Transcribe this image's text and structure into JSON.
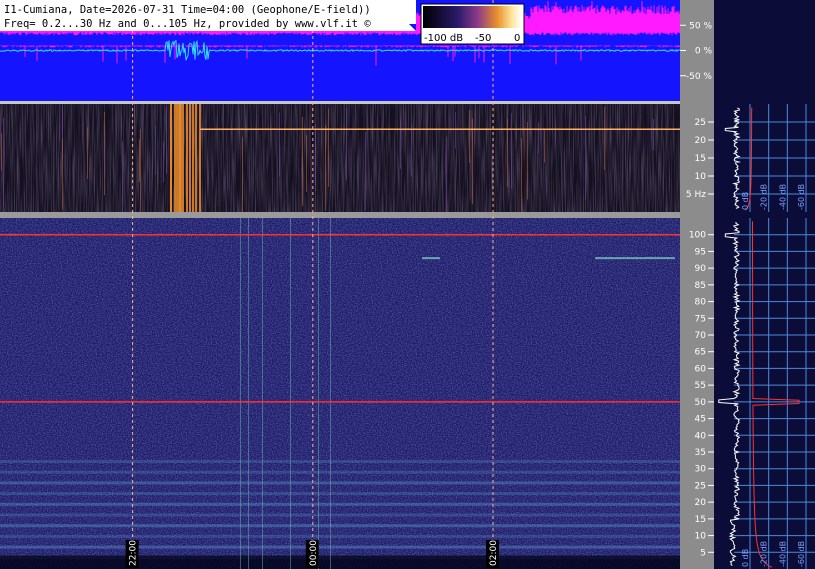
{
  "header": {
    "line1": "I1-Cumiana, Date=2026-07-31 Time=04:00 (Geophone/E-field))",
    "line2": "Freq= 0.2...30 Hz and 0...105 Hz, provided by www.vlf.it ©"
  },
  "colorbar": {
    "labels": [
      "-100 dB",
      "-50",
      "0"
    ]
  },
  "colors": {
    "top_background": "#1414ff",
    "amplitude_trace": "#ff1aff",
    "field_trace": "#30e0ff",
    "low_spec_bg": "#141020",
    "high_spec_bg": "#1c1c6a",
    "axis_panel": "#8c8c8c",
    "side_panel": "#0c0c38",
    "grid_line": "#4a8cd8",
    "marker_line": "#ff3030",
    "time_marker": "#ffb088"
  },
  "chart_data": [
    {
      "type": "line",
      "panel": "amplitude-percent",
      "ylim": [
        -100,
        100
      ],
      "yticks": [
        50,
        0,
        -50
      ],
      "ytick_labels": [
        "50 %",
        "0 %",
        "-50 %"
      ]
    },
    {
      "type": "heatmap",
      "panel": "spectrogram-low",
      "ylim": [
        0,
        30
      ],
      "yticks": [
        5,
        10,
        15,
        20,
        25
      ],
      "ytick_labels": [
        "5 Hz",
        "10",
        "15",
        "20",
        "25"
      ],
      "marker_frequencies": [
        23
      ]
    },
    {
      "type": "heatmap",
      "panel": "spectrogram-high",
      "ylim": [
        0,
        105
      ],
      "yticks": [
        5,
        10,
        15,
        20,
        25,
        30,
        35,
        40,
        45,
        50,
        55,
        60,
        65,
        70,
        75,
        80,
        85,
        90,
        95,
        100
      ],
      "ytick_labels": [
        "5",
        "10",
        "15",
        "20",
        "25",
        "30",
        "35",
        "40",
        "45",
        "50",
        "55",
        "60",
        "65",
        "70",
        "75",
        "80",
        "85",
        "90",
        "95",
        "100"
      ],
      "marker_frequencies": [
        100,
        50
      ]
    },
    {
      "type": "line",
      "panel": "spectrum-profile",
      "xticks": [
        0,
        -20,
        -40,
        -60
      ],
      "xtick_labels_low": [
        "0 dB",
        "-20 dB",
        "-40 dB",
        "-60 dB"
      ],
      "xtick_labels_high": [
        "0 dB",
        "-20 dB",
        "-40 dB",
        "-60 dB"
      ]
    }
  ],
  "time_axis": {
    "labels": [
      "22:00",
      "00:00",
      "02:00"
    ],
    "fractions": [
      0.195,
      0.46,
      0.725
    ]
  }
}
